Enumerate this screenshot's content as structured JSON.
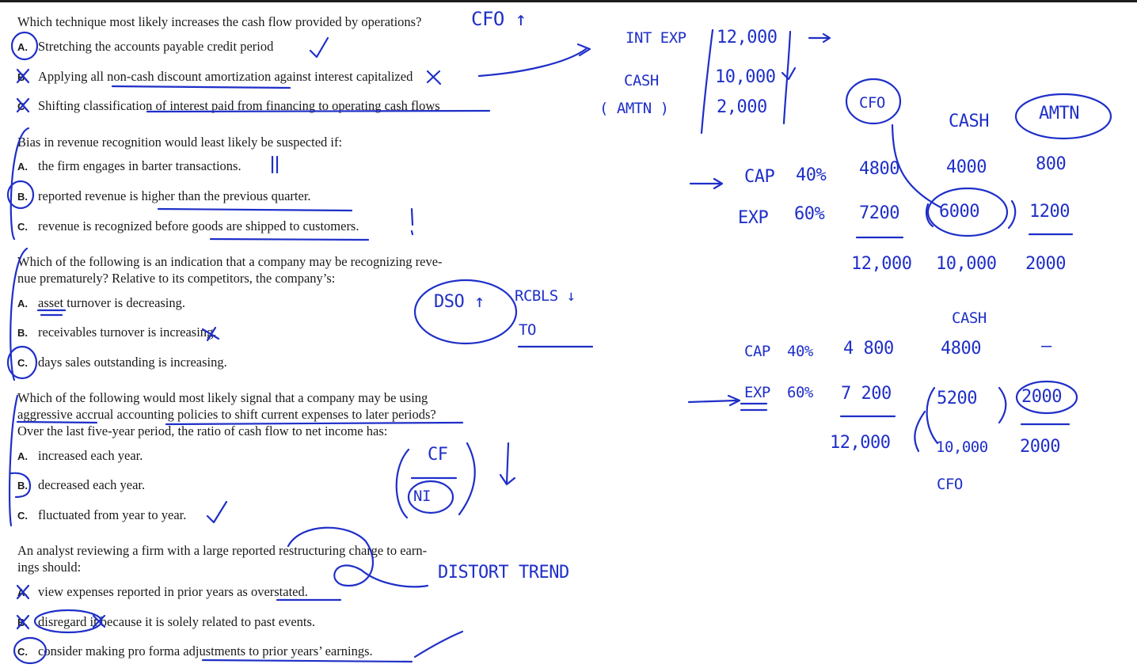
{
  "questions": [
    {
      "stem": "Which technique most likely increases the cash flow provided by operations?",
      "options": [
        {
          "letter": "A.",
          "text": "Stretching the accounts payable credit period"
        },
        {
          "letter": "B.",
          "text": "Applying all non-cash discount amortization against interest capitalized"
        },
        {
          "letter": "C.",
          "text": "Shifting classification of interest paid from financing to operating cash flows"
        }
      ]
    },
    {
      "stem": "Bias in revenue recognition would least likely be suspected if:",
      "options": [
        {
          "letter": "A.",
          "text": "the firm engages in barter transactions."
        },
        {
          "letter": "B.",
          "text": "reported revenue is higher than the previous quarter."
        },
        {
          "letter": "C.",
          "text": "revenue is recognized before goods are shipped to customers."
        }
      ]
    },
    {
      "stem_line1": "Which of the following is an indication that a company may be recognizing reve-",
      "stem_line2": "nue prematurely? Relative to its competitors, the company’s:",
      "options": [
        {
          "letter": "A.",
          "text": "asset turnover is decreasing."
        },
        {
          "letter": "B.",
          "text": "receivables turnover is increasing."
        },
        {
          "letter": "C.",
          "text": "days sales outstanding is increasing."
        }
      ]
    },
    {
      "stem_line1": "Which of the following would most likely signal that a company may be using",
      "stem_line2": "aggressive accrual accounting policies to shift current expenses to later periods?",
      "stem_line3": "Over the last five-year period, the ratio of cash flow to net income has:",
      "options": [
        {
          "letter": "A.",
          "text": "increased each year."
        },
        {
          "letter": "B.",
          "text": "decreased each year."
        },
        {
          "letter": "C.",
          "text": "fluctuated from year to year."
        }
      ]
    },
    {
      "stem_line1": "An analyst reviewing a firm with a large reported restructuring charge to earn-",
      "stem_line2": "ings should:",
      "options": [
        {
          "letter": "A.",
          "text": "view expenses reported in prior years as overstated."
        },
        {
          "letter": "B.",
          "text": "disregard it because it is solely related to past events."
        },
        {
          "letter": "C.",
          "text": "consider making pro forma adjustments to prior years’ earnings."
        }
      ]
    }
  ],
  "annotations": {
    "cfo_up": "CFO ↑",
    "int_exp": "INT EXP",
    "cash": "CASH",
    "amtn": "( AMTN )",
    "v12000": "12,000",
    "v10000": "10,000",
    "v2000": "2,000",
    "cfo": "CFO",
    "cash_head": "CASH",
    "amtn_head": "AMTN",
    "cap": "CAP",
    "cap_pct": "40%",
    "cap_val": "4800",
    "cap_cash": "4000",
    "cap_amtn": "800",
    "exp": "EXP",
    "exp_pct": "60%",
    "exp_val": "7200",
    "exp_cash": "6000",
    "exp_amtn": "1200",
    "tot_12000": "12,000",
    "tot_10000": "10,000",
    "tot_2000": "2000",
    "cash2": "CASH",
    "cap2": "CAP",
    "cap2_pct": "40%",
    "cap2_val": "4 800",
    "cap2_cash": "4800",
    "cap2_dash": "–",
    "exp2": "EXP",
    "exp2_pct": "60%",
    "exp2_val": "7 200",
    "exp2_cash": "5200",
    "exp2_amtn": "2000",
    "tot2_12000": "12,000",
    "tot2_10000": "10,000",
    "tot2_2000": "2000",
    "cfo2": "CFO",
    "dso_up": "DSO ↑",
    "recbls_down": "RCBLS ↓",
    "to": "TO",
    "cf": "CF",
    "ni": "NI",
    "distort_trend": "DISTORT TREND"
  }
}
